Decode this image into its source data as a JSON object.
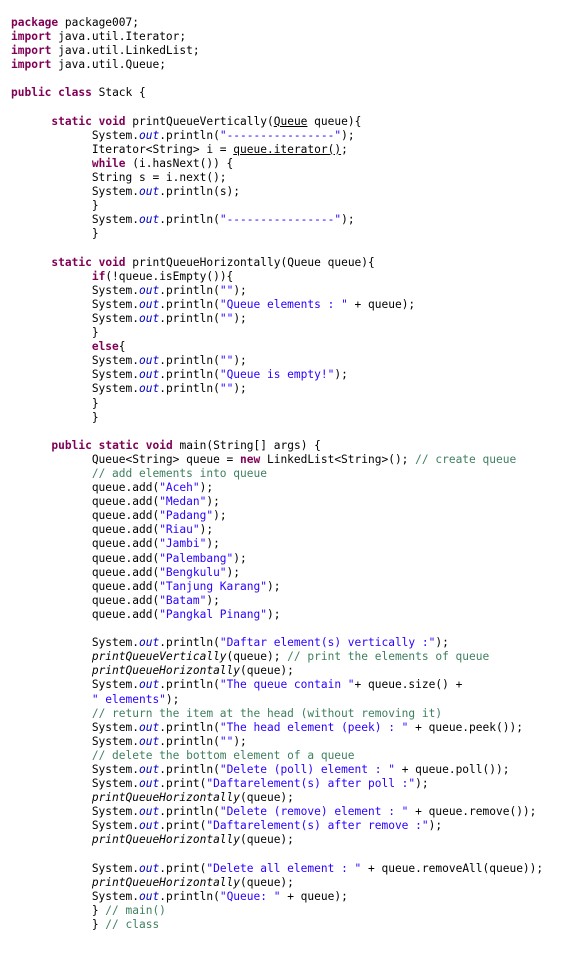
{
  "editor": {
    "language": "java",
    "colors": {
      "keyword": "#7f0055",
      "string": "#2a00ff",
      "comment": "#3f7f5f",
      "field": "#0000c0",
      "text": "#000000",
      "background": "#ffffff"
    },
    "lines": [
      [
        {
          "t": "kw",
          "v": "package"
        },
        {
          "t": "",
          "v": " package007;"
        }
      ],
      [
        {
          "t": "kw",
          "v": "import"
        },
        {
          "t": "",
          "v": " java.util.Iterator;"
        }
      ],
      [
        {
          "t": "kw",
          "v": "import"
        },
        {
          "t": "",
          "v": " java.util.LinkedList;"
        }
      ],
      [
        {
          "t": "kw",
          "v": "import"
        },
        {
          "t": "",
          "v": " java.util.Queue;"
        }
      ],
      [],
      [
        {
          "t": "kw",
          "v": "public"
        },
        {
          "t": "",
          "v": " "
        },
        {
          "t": "kw",
          "v": "class"
        },
        {
          "t": "",
          "v": " Stack {"
        }
      ],
      [],
      [
        {
          "t": "",
          "v": "      "
        },
        {
          "t": "kw",
          "v": "static"
        },
        {
          "t": "",
          "v": " "
        },
        {
          "t": "kw",
          "v": "void"
        },
        {
          "t": "",
          "v": " printQueueVertically("
        },
        {
          "t": "ul",
          "v": "Queue"
        },
        {
          "t": "",
          "v": " queue){"
        }
      ],
      [
        {
          "t": "",
          "v": "            System."
        },
        {
          "t": "fld",
          "v": "out"
        },
        {
          "t": "",
          "v": ".println("
        },
        {
          "t": "str",
          "v": "\"----------------\""
        },
        {
          "t": "",
          "v": ");"
        }
      ],
      [
        {
          "t": "",
          "v": "            Iterator<String> i = "
        },
        {
          "t": "ul",
          "v": "queue.iterator()"
        },
        {
          "t": "",
          "v": ";"
        }
      ],
      [
        {
          "t": "",
          "v": "            "
        },
        {
          "t": "kw",
          "v": "while"
        },
        {
          "t": "",
          "v": " (i.hasNext()) {"
        }
      ],
      [
        {
          "t": "",
          "v": "            String s = i.next();"
        }
      ],
      [
        {
          "t": "",
          "v": "            System."
        },
        {
          "t": "fld",
          "v": "out"
        },
        {
          "t": "",
          "v": ".println(s);"
        }
      ],
      [
        {
          "t": "",
          "v": "            }"
        }
      ],
      [
        {
          "t": "",
          "v": "            System."
        },
        {
          "t": "fld",
          "v": "out"
        },
        {
          "t": "",
          "v": ".println("
        },
        {
          "t": "str",
          "v": "\"----------------\""
        },
        {
          "t": "",
          "v": ");"
        }
      ],
      [
        {
          "t": "",
          "v": "            }"
        }
      ],
      [],
      [
        {
          "t": "",
          "v": "      "
        },
        {
          "t": "kw",
          "v": "static"
        },
        {
          "t": "",
          "v": " "
        },
        {
          "t": "kw",
          "v": "void"
        },
        {
          "t": "",
          "v": " printQueueHorizontally(Queue queue){"
        }
      ],
      [
        {
          "t": "",
          "v": "            "
        },
        {
          "t": "kw",
          "v": "if"
        },
        {
          "t": "",
          "v": "(!queue.isEmpty()){"
        }
      ],
      [
        {
          "t": "",
          "v": "            System."
        },
        {
          "t": "fld",
          "v": "out"
        },
        {
          "t": "",
          "v": ".println("
        },
        {
          "t": "str",
          "v": "\"\""
        },
        {
          "t": "",
          "v": ");"
        }
      ],
      [
        {
          "t": "",
          "v": "            System."
        },
        {
          "t": "fld",
          "v": "out"
        },
        {
          "t": "",
          "v": ".println("
        },
        {
          "t": "str",
          "v": "\"Queue elements : \""
        },
        {
          "t": "",
          "v": " + queue);"
        }
      ],
      [
        {
          "t": "",
          "v": "            System."
        },
        {
          "t": "fld",
          "v": "out"
        },
        {
          "t": "",
          "v": ".println("
        },
        {
          "t": "str",
          "v": "\"\""
        },
        {
          "t": "",
          "v": ");"
        }
      ],
      [
        {
          "t": "",
          "v": "            }"
        }
      ],
      [
        {
          "t": "",
          "v": "            "
        },
        {
          "t": "kw",
          "v": "else"
        },
        {
          "t": "",
          "v": "{"
        }
      ],
      [
        {
          "t": "",
          "v": "            System."
        },
        {
          "t": "fld",
          "v": "out"
        },
        {
          "t": "",
          "v": ".println("
        },
        {
          "t": "str",
          "v": "\"\""
        },
        {
          "t": "",
          "v": ");"
        }
      ],
      [
        {
          "t": "",
          "v": "            System."
        },
        {
          "t": "fld",
          "v": "out"
        },
        {
          "t": "",
          "v": ".println("
        },
        {
          "t": "str",
          "v": "\"Queue is empty!\""
        },
        {
          "t": "",
          "v": ");"
        }
      ],
      [
        {
          "t": "",
          "v": "            System."
        },
        {
          "t": "fld",
          "v": "out"
        },
        {
          "t": "",
          "v": ".println("
        },
        {
          "t": "str",
          "v": "\"\""
        },
        {
          "t": "",
          "v": ");"
        }
      ],
      [
        {
          "t": "",
          "v": "            }"
        }
      ],
      [
        {
          "t": "",
          "v": "            }"
        }
      ],
      [],
      [
        {
          "t": "",
          "v": "      "
        },
        {
          "t": "kw",
          "v": "public"
        },
        {
          "t": "",
          "v": " "
        },
        {
          "t": "kw",
          "v": "static"
        },
        {
          "t": "",
          "v": " "
        },
        {
          "t": "kw",
          "v": "void"
        },
        {
          "t": "",
          "v": " main(String[] args) {"
        }
      ],
      [
        {
          "t": "",
          "v": "            Queue<String> queue = "
        },
        {
          "t": "kw",
          "v": "new"
        },
        {
          "t": "",
          "v": " LinkedList<String>(); "
        },
        {
          "t": "com",
          "v": "// create queue"
        }
      ],
      [
        {
          "t": "",
          "v": "            "
        },
        {
          "t": "com",
          "v": "// add elements into queue"
        }
      ],
      [
        {
          "t": "",
          "v": "            queue.add("
        },
        {
          "t": "str",
          "v": "\"Aceh\""
        },
        {
          "t": "",
          "v": ");"
        }
      ],
      [
        {
          "t": "",
          "v": "            queue.add("
        },
        {
          "t": "str",
          "v": "\"Medan\""
        },
        {
          "t": "",
          "v": ");"
        }
      ],
      [
        {
          "t": "",
          "v": "            queue.add("
        },
        {
          "t": "str",
          "v": "\"Padang\""
        },
        {
          "t": "",
          "v": ");"
        }
      ],
      [
        {
          "t": "",
          "v": "            queue.add("
        },
        {
          "t": "str",
          "v": "\"Riau\""
        },
        {
          "t": "",
          "v": ");"
        }
      ],
      [
        {
          "t": "",
          "v": "            queue.add("
        },
        {
          "t": "str",
          "v": "\"Jambi\""
        },
        {
          "t": "",
          "v": ");"
        }
      ],
      [
        {
          "t": "",
          "v": "            queue.add("
        },
        {
          "t": "str",
          "v": "\"Palembang\""
        },
        {
          "t": "",
          "v": ");"
        }
      ],
      [
        {
          "t": "",
          "v": "            queue.add("
        },
        {
          "t": "str",
          "v": "\"Bengkulu\""
        },
        {
          "t": "",
          "v": ");"
        }
      ],
      [
        {
          "t": "",
          "v": "            queue.add("
        },
        {
          "t": "str",
          "v": "\"Tanjung Karang\""
        },
        {
          "t": "",
          "v": ");"
        }
      ],
      [
        {
          "t": "",
          "v": "            queue.add("
        },
        {
          "t": "str",
          "v": "\"Batam\""
        },
        {
          "t": "",
          "v": ");"
        }
      ],
      [
        {
          "t": "",
          "v": "            queue.add("
        },
        {
          "t": "str",
          "v": "\"Pangkal Pinang\""
        },
        {
          "t": "",
          "v": ");"
        }
      ],
      [],
      [
        {
          "t": "",
          "v": "            System."
        },
        {
          "t": "fld",
          "v": "out"
        },
        {
          "t": "",
          "v": ".println("
        },
        {
          "t": "str",
          "v": "\"Daftar element(s) vertically :\""
        },
        {
          "t": "",
          "v": ");"
        }
      ],
      [
        {
          "t": "",
          "v": "            "
        },
        {
          "t": "ital",
          "v": "printQueueVertically"
        },
        {
          "t": "",
          "v": "(queue); "
        },
        {
          "t": "com",
          "v": "// print the elements of queue"
        }
      ],
      [
        {
          "t": "",
          "v": "            "
        },
        {
          "t": "ital",
          "v": "printQueueHorizontally"
        },
        {
          "t": "",
          "v": "(queue);"
        }
      ],
      [
        {
          "t": "",
          "v": "            System."
        },
        {
          "t": "fld",
          "v": "out"
        },
        {
          "t": "",
          "v": ".println("
        },
        {
          "t": "str",
          "v": "\"The queue contain \""
        },
        {
          "t": "",
          "v": "+ queue.size() +"
        }
      ],
      [
        {
          "t": "",
          "v": "            "
        },
        {
          "t": "str",
          "v": "\" elements\""
        },
        {
          "t": "",
          "v": ");"
        }
      ],
      [
        {
          "t": "",
          "v": "            "
        },
        {
          "t": "com",
          "v": "// return the item at the head (without removing it)"
        }
      ],
      [
        {
          "t": "",
          "v": "            System."
        },
        {
          "t": "fld",
          "v": "out"
        },
        {
          "t": "",
          "v": ".println("
        },
        {
          "t": "str",
          "v": "\"The head element (peek) : \""
        },
        {
          "t": "",
          "v": " + queue.peek());"
        }
      ],
      [
        {
          "t": "",
          "v": "            System."
        },
        {
          "t": "fld",
          "v": "out"
        },
        {
          "t": "",
          "v": ".println("
        },
        {
          "t": "str",
          "v": "\"\""
        },
        {
          "t": "",
          "v": ");"
        }
      ],
      [
        {
          "t": "",
          "v": "            "
        },
        {
          "t": "com",
          "v": "// delete the bottom element of a queue"
        }
      ],
      [
        {
          "t": "",
          "v": "            System."
        },
        {
          "t": "fld",
          "v": "out"
        },
        {
          "t": "",
          "v": ".println("
        },
        {
          "t": "str",
          "v": "\"Delete (poll) element : \""
        },
        {
          "t": "",
          "v": " + queue.poll());"
        }
      ],
      [
        {
          "t": "",
          "v": "            System."
        },
        {
          "t": "fld",
          "v": "out"
        },
        {
          "t": "",
          "v": ".print("
        },
        {
          "t": "str",
          "v": "\"Daftarelement(s) after poll :\""
        },
        {
          "t": "",
          "v": ");"
        }
      ],
      [
        {
          "t": "",
          "v": "            "
        },
        {
          "t": "ital",
          "v": "printQueueHorizontally"
        },
        {
          "t": "",
          "v": "(queue);"
        }
      ],
      [
        {
          "t": "",
          "v": "            System."
        },
        {
          "t": "fld",
          "v": "out"
        },
        {
          "t": "",
          "v": ".println("
        },
        {
          "t": "str",
          "v": "\"Delete (remove) element : \""
        },
        {
          "t": "",
          "v": " + queue.remove());"
        }
      ],
      [
        {
          "t": "",
          "v": "            System."
        },
        {
          "t": "fld",
          "v": "out"
        },
        {
          "t": "",
          "v": ".print("
        },
        {
          "t": "str",
          "v": "\"Daftarelement(s) after remove :\""
        },
        {
          "t": "",
          "v": ");"
        }
      ],
      [
        {
          "t": "",
          "v": "            "
        },
        {
          "t": "ital",
          "v": "printQueueHorizontally"
        },
        {
          "t": "",
          "v": "(queue);"
        }
      ],
      [],
      [
        {
          "t": "",
          "v": "            System."
        },
        {
          "t": "fld",
          "v": "out"
        },
        {
          "t": "",
          "v": ".print("
        },
        {
          "t": "str",
          "v": "\"Delete all element : \""
        },
        {
          "t": "",
          "v": " + queue.removeAll(queue));"
        }
      ],
      [
        {
          "t": "",
          "v": "            "
        },
        {
          "t": "ital",
          "v": "printQueueHorizontally"
        },
        {
          "t": "",
          "v": "(queue);"
        }
      ],
      [
        {
          "t": "",
          "v": "            System."
        },
        {
          "t": "fld",
          "v": "out"
        },
        {
          "t": "",
          "v": ".println("
        },
        {
          "t": "str",
          "v": "\"Queue: \""
        },
        {
          "t": "",
          "v": " + queue);"
        }
      ],
      [
        {
          "t": "",
          "v": "            } "
        },
        {
          "t": "com",
          "v": "// main()"
        }
      ],
      [
        {
          "t": "",
          "v": "            } "
        },
        {
          "t": "com",
          "v": "// class"
        }
      ]
    ]
  }
}
